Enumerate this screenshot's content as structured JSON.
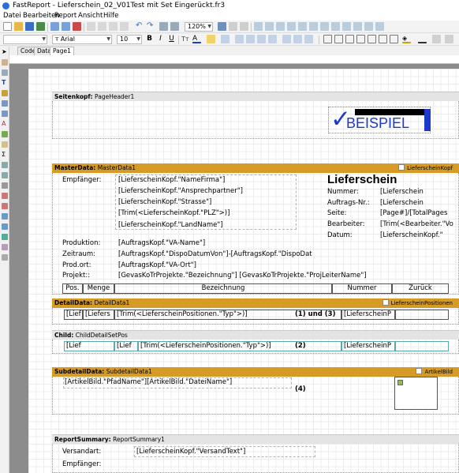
{
  "window": {
    "title": "FastReport - Lieferschein_02_V01Test mit Set Eingerückt.fr3"
  },
  "menu": [
    "Datei",
    "Bearbeiten",
    "Report",
    "Ansicht",
    "Hilfe"
  ],
  "toolbar": {
    "zoom": "120%",
    "font_name": "Arial",
    "font_size": "10"
  },
  "tabs": [
    "Code",
    "Data",
    "Page1"
  ],
  "bands": {
    "page_header": {
      "kind": "Seitenkopf:",
      "name": "PageHeader1",
      "logo_text": "BEISPIEL"
    },
    "master": {
      "kind": "MasterData:",
      "name": "MasterData1",
      "dataset": "LieferscheinKopf"
    },
    "detail": {
      "kind": "DetailData:",
      "name": "DetailData1",
      "dataset": "LieferscheinPositionen"
    },
    "child": {
      "kind": "Child:",
      "name": "ChildDetailSetPos"
    },
    "subdetail": {
      "kind": "SubdetailData:",
      "name": "SubdetailData1",
      "dataset": "ArtikelBild"
    },
    "summary": {
      "kind": "ReportSummary:",
      "name": "ReportSummary1"
    }
  },
  "master_fields": {
    "empfaenger_label": "Empfänger:",
    "firma": "[LieferscheinKopf.\"NameFirma\"]",
    "ansprech": "[LieferscheinKopf.\"Ansprechpartner\"]",
    "strasse": "[LieferscheinKopf.\"Strasse\"]",
    "plz": "[Trim(<LieferscheinKopf.\"PLZ\">)]",
    "land": "[LieferscheinKopf.\"LandName\"]",
    "title": "Lieferschein",
    "nummer_label": "Nummer:",
    "nummer_val": "[Lieferschein",
    "auftrag_label": "Auftrags-Nr.:",
    "auftrag_val": "[Lieferschein",
    "seite_label": "Seite:",
    "seite_val": "[Page#]/[TotalPages",
    "bearbeiter_label": "Bearbeiter:",
    "bearbeiter_val": "[Trim(<Bearbeiter.\"Vo",
    "datum_label": "Datum:",
    "datum_val": "[LieferscheinKopf.\"",
    "produktion_label": "Produktion:",
    "produktion_val": "[AuftragsKopf.\"VA-Name\"]",
    "zeitraum_label": "Zeitraum:",
    "zeitraum_val": "[AuftragsKopf.\"DispoDatumVon\"]-[AuftragsKopf.\"DispoDat",
    "prodort_label": "Prod.ort:",
    "prodort_val": "[AuftragsKopf.\"VA-Ort\"]",
    "projekt_label": "Projekt::",
    "projekt_val": "[GevasKoTrProjekte.\"Bezeichnung\"] [GevasKoTrProjekte.\"ProjLeiterName\"]",
    "col_pos": "Pos.",
    "col_menge": "Menge",
    "col_bez": "Bezeichnung",
    "col_nummer": "Nummer",
    "col_zurueck": "Zurück"
  },
  "detail_fields": {
    "c1": "[Lief",
    "c2": "[Liefers",
    "c3": "[Trim(<LieferscheinPositionen.\"Typ\">)]",
    "note": "(1) und (3)",
    "c5": "[LieferscheinP"
  },
  "child_fields": {
    "c1": "[Lief",
    "c3": "[Lief",
    "c4": "[Trim(<LieferscheinPositionen.\"Typ\">)]",
    "note": "(2)",
    "c5": "[LieferscheinP"
  },
  "subdetail_fields": {
    "path": "[ArtikelBild.\"PfadName\"][ArtikelBild.\"DateiName\"]",
    "note": "(4)"
  },
  "summary_fields": {
    "versandart_label": "Versandart:",
    "versandart_val": "[LieferscheinKopf.\"VersandText\"]",
    "empfaenger_label": "Empfänger:"
  }
}
